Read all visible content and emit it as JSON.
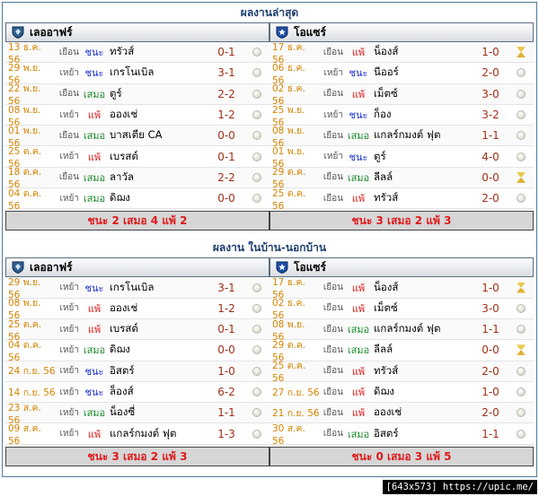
{
  "recent": {
    "title": "ผลงานล่าสุด",
    "left": {
      "team": "เลออาฟร์",
      "summary": "ชนะ 2 เสมอ 4 แพ้ 2",
      "matches": [
        {
          "date": "13 ธ.ค. 56",
          "ha": "เยือน",
          "result": "ชนะ",
          "rc": "win",
          "opponent": "ทรัวส์",
          "score": "0-1",
          "icon": "ball"
        },
        {
          "date": "29 พ.ย. 56",
          "ha": "เหย้า",
          "result": "ชนะ",
          "rc": "win",
          "opponent": "เกรโนเบิล",
          "score": "3-1",
          "icon": "ball"
        },
        {
          "date": "22 พ.ย. 56",
          "ha": "เยือน",
          "result": "เสมอ",
          "rc": "draw",
          "opponent": "ตูร์",
          "score": "2-2",
          "icon": "ball"
        },
        {
          "date": "08 พ.ย. 56",
          "ha": "เหย้า",
          "result": "แพ้",
          "rc": "loss",
          "opponent": "อองเช่",
          "score": "1-2",
          "icon": "ball"
        },
        {
          "date": "01 พ.ย. 56",
          "ha": "เยือน",
          "result": "เสมอ",
          "rc": "draw",
          "opponent": "บาสเตีย CA",
          "score": "0-0",
          "icon": "ball"
        },
        {
          "date": "25 ต.ค. 56",
          "ha": "เหย้า",
          "result": "แพ้",
          "rc": "loss",
          "opponent": "เบรสต์",
          "score": "0-1",
          "icon": "ball"
        },
        {
          "date": "18 ต.ค. 56",
          "ha": "เยือน",
          "result": "เสมอ",
          "rc": "draw",
          "opponent": "ลาวัล",
          "score": "2-2",
          "icon": "ball"
        },
        {
          "date": "04 ต.ค. 56",
          "ha": "เหย้า",
          "result": "เสมอ",
          "rc": "draw",
          "opponent": "ดิฌง",
          "score": "0-0",
          "icon": "ball"
        }
      ]
    },
    "right": {
      "team": "โอแซร์",
      "summary": "ชนะ 3 เสมอ 2 แพ้ 3",
      "matches": [
        {
          "date": "17 ธ.ค. 56",
          "ha": "เยือน",
          "result": "แพ้",
          "rc": "loss",
          "opponent": "น็องส์",
          "score": "1-0",
          "icon": "hourglass"
        },
        {
          "date": "06 ธ.ค. 56",
          "ha": "เหย้า",
          "result": "ชนะ",
          "rc": "win",
          "opponent": "นีออร์",
          "score": "2-0",
          "icon": "ball"
        },
        {
          "date": "02 ธ.ค. 56",
          "ha": "เยือน",
          "result": "แพ้",
          "rc": "loss",
          "opponent": "เม็ตซ์",
          "score": "3-0",
          "icon": "ball"
        },
        {
          "date": "25 พ.ย. 56",
          "ha": "เหย้า",
          "result": "ชนะ",
          "rc": "win",
          "opponent": "ก็อง",
          "score": "3-2",
          "icon": "ball"
        },
        {
          "date": "08 พ.ย. 56",
          "ha": "เยือน",
          "result": "เสมอ",
          "rc": "draw",
          "opponent": "แกลร์กมงต์ ฟุต",
          "score": "1-1",
          "icon": "ball"
        },
        {
          "date": "01 พ.ย. 56",
          "ha": "เหย้า",
          "result": "ชนะ",
          "rc": "win",
          "opponent": "ตูร์",
          "score": "4-0",
          "icon": "ball"
        },
        {
          "date": "29 ต.ค. 56",
          "ha": "เยือน",
          "result": "เสมอ",
          "rc": "draw",
          "opponent": "ลีลล์",
          "score": "0-0",
          "icon": "hourglass"
        },
        {
          "date": "25 ต.ค. 56",
          "ha": "เยือน",
          "result": "แพ้",
          "rc": "loss",
          "opponent": "ทรัวส์",
          "score": "2-0",
          "icon": "ball"
        }
      ]
    }
  },
  "homeaway": {
    "title": "ผลงาน ในบ้าน-นอกบ้าน",
    "left": {
      "team": "เลออาฟร์",
      "summary": "ชนะ 3 เสมอ 2 แพ้ 3",
      "matches": [
        {
          "date": "29 พ.ย. 56",
          "ha": "เหย้า",
          "result": "ชนะ",
          "rc": "win",
          "opponent": "เกรโนเบิล",
          "score": "3-1",
          "icon": "ball"
        },
        {
          "date": "08 พ.ย. 56",
          "ha": "เหย้า",
          "result": "แพ้",
          "rc": "loss",
          "opponent": "อองเช่",
          "score": "1-2",
          "icon": "ball"
        },
        {
          "date": "25 ต.ค. 56",
          "ha": "เหย้า",
          "result": "แพ้",
          "rc": "loss",
          "opponent": "เบรสต์",
          "score": "0-1",
          "icon": "ball"
        },
        {
          "date": "04 ต.ค. 56",
          "ha": "เหย้า",
          "result": "เสมอ",
          "rc": "draw",
          "opponent": "ดิฌง",
          "score": "0-0",
          "icon": "ball"
        },
        {
          "date": "24 ก.ย. 56",
          "ha": "เหย้า",
          "result": "ชนะ",
          "rc": "win",
          "opponent": "อิสตร์",
          "score": "1-0",
          "icon": "ball"
        },
        {
          "date": "14 ก.ย. 56",
          "ha": "เหย้า",
          "result": "ชนะ",
          "rc": "win",
          "opponent": "ล็องส์",
          "score": "6-2",
          "icon": "ball"
        },
        {
          "date": "23 ส.ค. 56",
          "ha": "เหย้า",
          "result": "เสมอ",
          "rc": "draw",
          "opponent": "น็องซี่",
          "score": "1-1",
          "icon": "ball"
        },
        {
          "date": "09 ส.ค. 56",
          "ha": "เหย้า",
          "result": "แพ้",
          "rc": "loss",
          "opponent": "แกลร์กมงต์ ฟุต",
          "score": "1-3",
          "icon": "ball"
        }
      ]
    },
    "right": {
      "team": "โอแซร์",
      "summary": "ชนะ 0 เสมอ 3 แพ้ 5",
      "matches": [
        {
          "date": "17 ธ.ค. 56",
          "ha": "เยือน",
          "result": "แพ้",
          "rc": "loss",
          "opponent": "น็องส์",
          "score": "1-0",
          "icon": "hourglass"
        },
        {
          "date": "02 ธ.ค. 56",
          "ha": "เยือน",
          "result": "แพ้",
          "rc": "loss",
          "opponent": "เม็ตซ์",
          "score": "3-0",
          "icon": "ball"
        },
        {
          "date": "08 พ.ย. 56",
          "ha": "เยือน",
          "result": "เสมอ",
          "rc": "draw",
          "opponent": "แกลร์กมงต์ ฟุต",
          "score": "1-1",
          "icon": "ball"
        },
        {
          "date": "29 ต.ค. 56",
          "ha": "เยือน",
          "result": "เสมอ",
          "rc": "draw",
          "opponent": "ลีลล์",
          "score": "0-0",
          "icon": "hourglass"
        },
        {
          "date": "25 ต.ค. 56",
          "ha": "เยือน",
          "result": "แพ้",
          "rc": "loss",
          "opponent": "ทรัวส์",
          "score": "2-0",
          "icon": "ball"
        },
        {
          "date": "27 ก.ย. 56",
          "ha": "เยือน",
          "result": "แพ้",
          "rc": "loss",
          "opponent": "ดิฌง",
          "score": "1-0",
          "icon": "ball"
        },
        {
          "date": "21 ก.ย. 56",
          "ha": "เยือน",
          "result": "แพ้",
          "rc": "loss",
          "opponent": "อองเช่",
          "score": "2-0",
          "icon": "ball"
        },
        {
          "date": "30 ส.ค. 56",
          "ha": "เยือน",
          "result": "เสมอ",
          "rc": "draw",
          "opponent": "อิสตร์",
          "score": "1-1",
          "icon": "ball"
        }
      ]
    }
  },
  "watermark": "[643x573] https://upic.me/"
}
